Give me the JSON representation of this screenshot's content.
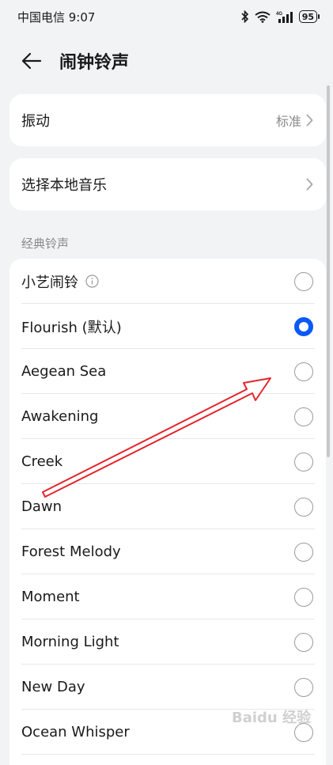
{
  "status_bar": {
    "carrier_time": "中国电信 9:07",
    "battery": "95",
    "icons": [
      "bluetooth-icon",
      "wifi-icon",
      "cellular-4g-icon",
      "battery-icon"
    ]
  },
  "header": {
    "title": "闹钟铃声"
  },
  "vibration": {
    "label": "振动",
    "value": "标准"
  },
  "local_music": {
    "label": "选择本地音乐"
  },
  "section": {
    "title": "经典铃声"
  },
  "ringtones": [
    {
      "label": "小艺闹铃",
      "info": true,
      "selected": false
    },
    {
      "label": "Flourish (默认)",
      "selected": true
    },
    {
      "label": "Aegean Sea",
      "selected": false
    },
    {
      "label": "Awakening",
      "selected": false
    },
    {
      "label": "Creek",
      "selected": false
    },
    {
      "label": "Dawn",
      "selected": false
    },
    {
      "label": "Forest Melody",
      "selected": false
    },
    {
      "label": "Moment",
      "selected": false
    },
    {
      "label": "Morning Light",
      "selected": false
    },
    {
      "label": "New Day",
      "selected": false
    },
    {
      "label": "Ocean Whisper",
      "selected": false
    }
  ],
  "colors": {
    "accent": "#0a59f7",
    "annotation_arrow": "#e4262d"
  },
  "watermark": "Baidu 经验"
}
